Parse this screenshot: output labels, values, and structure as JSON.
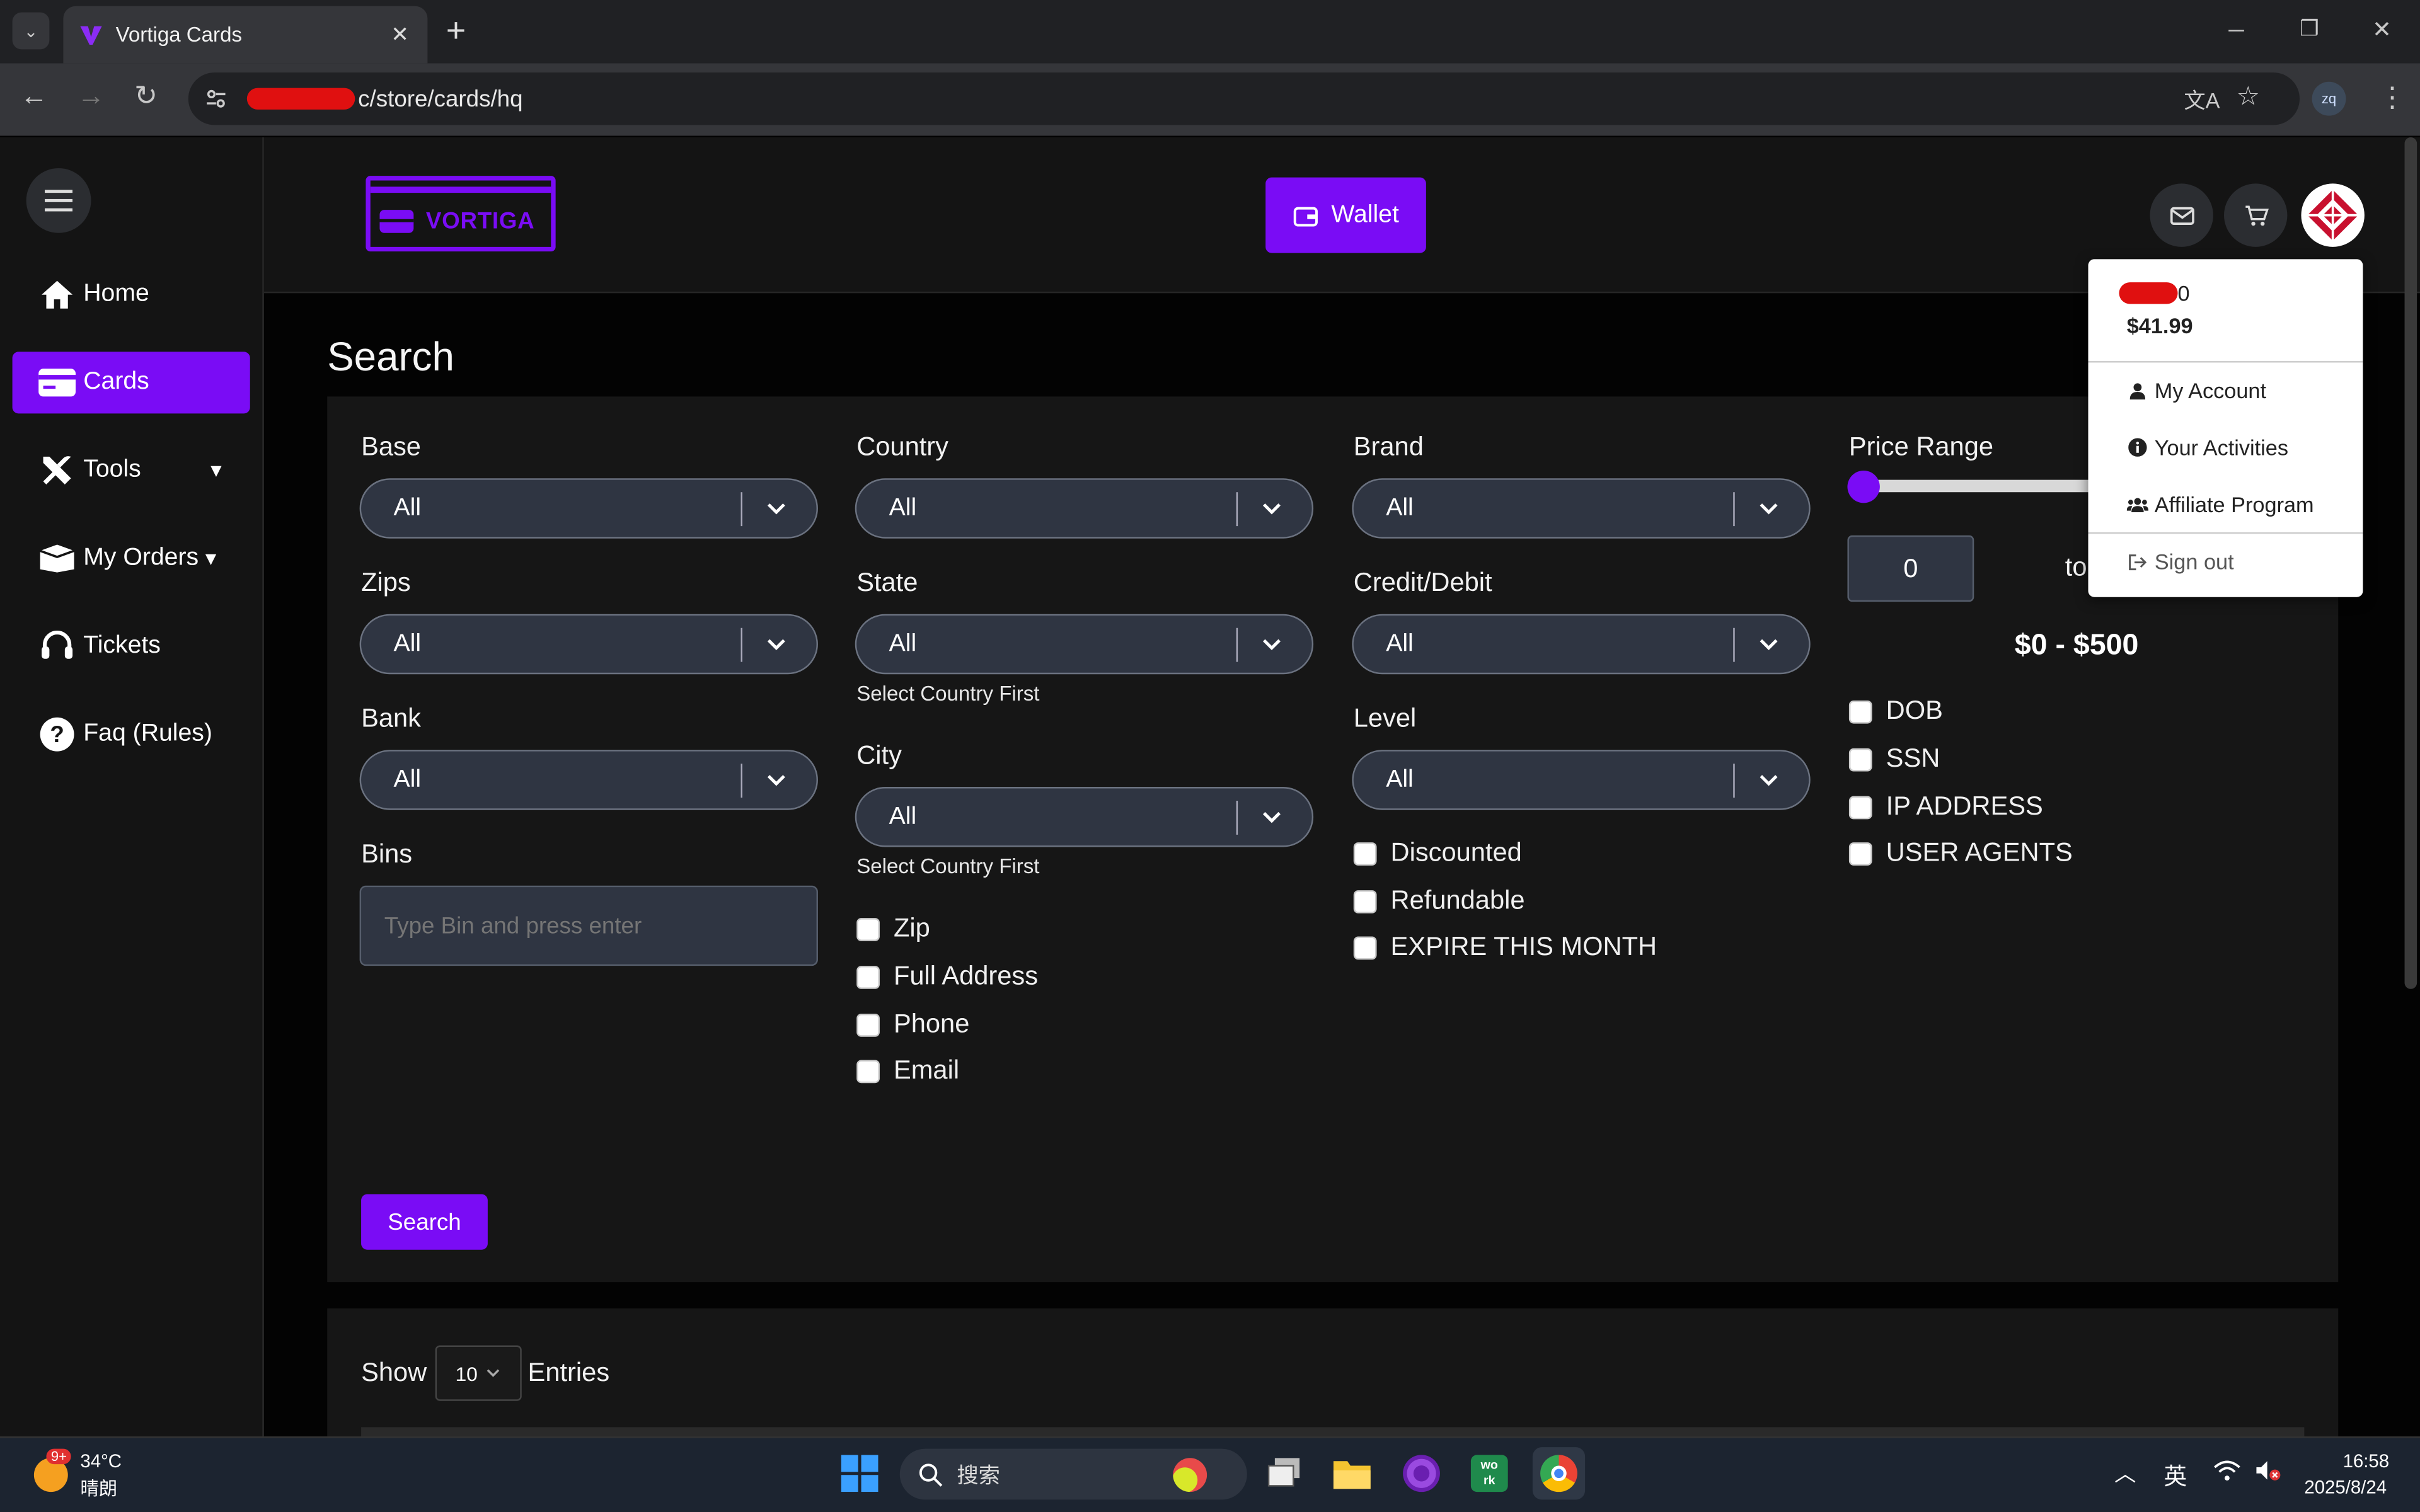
{
  "browser": {
    "tab_title": "Vortiga Cards",
    "new_tab": "+",
    "url": "c/store/cards/hq",
    "profile": "zq",
    "window_controls": {
      "minimize": "─",
      "restore": "❐",
      "close": "✕"
    }
  },
  "app": {
    "logo_text": "VORTIGA",
    "wallet_label": "Wallet",
    "colors": {
      "accent": "#7a0cf5",
      "background": "#030303",
      "sidebar": "#141414",
      "panel": "#161616",
      "field": "#2f3542"
    }
  },
  "sidebar": {
    "items": [
      {
        "label": "Home",
        "icon": "home-icon"
      },
      {
        "label": "Cards",
        "icon": "credit-card-icon",
        "active": true
      },
      {
        "label": "Tools",
        "icon": "tools-icon"
      },
      {
        "label": "My Orders",
        "icon": "box-icon"
      },
      {
        "label": "Tickets",
        "icon": "headset-icon"
      },
      {
        "label": "Faq (Rules)",
        "icon": "question-circle-icon"
      }
    ]
  },
  "account_menu": {
    "username_suffix": "0",
    "balance": "$41.99",
    "items": [
      "My Account",
      "Your Activities",
      "Affiliate Program",
      "Sign out"
    ]
  },
  "search": {
    "title": "Search",
    "fields": {
      "base": {
        "label": "Base",
        "value": "All"
      },
      "zips": {
        "label": "Zips",
        "value": "All"
      },
      "bank": {
        "label": "Bank",
        "value": "All"
      },
      "bins": {
        "label": "Bins",
        "placeholder": "Type Bin and press enter"
      },
      "country": {
        "label": "Country",
        "value": "All"
      },
      "state": {
        "label": "State",
        "value": "All",
        "hint": "Select Country First"
      },
      "city": {
        "label": "City",
        "value": "All",
        "hint": "Select Country First"
      },
      "brand": {
        "label": "Brand",
        "value": "All"
      },
      "credit_debit": {
        "label": "Credit/Debit",
        "value": "All"
      },
      "level": {
        "label": "Level",
        "value": "All"
      }
    },
    "checkboxes_col2": [
      "Zip",
      "Full Address",
      "Phone",
      "Email"
    ],
    "checkboxes_col3": [
      "Discounted",
      "Refundable",
      "EXPIRE THIS MONTH"
    ],
    "checkboxes_col4": [
      "DOB",
      "SSN",
      "IP ADDRESS",
      "USER AGENTS"
    ],
    "price": {
      "label": "Price Range",
      "min_value": "0",
      "to_label": "to",
      "range_text": "$0 - $500",
      "slider_level": 0
    },
    "submit_label": "Search"
  },
  "table": {
    "show_label": "Show",
    "entries_value": "10",
    "entries_label": "Entries"
  },
  "taskbar": {
    "weather_temp": "34°C",
    "weather_desc": "晴朗",
    "weather_badge": "9+",
    "search_placeholder": "搜索",
    "ime": "英",
    "time": "16:58",
    "date": "2025/8/24"
  }
}
